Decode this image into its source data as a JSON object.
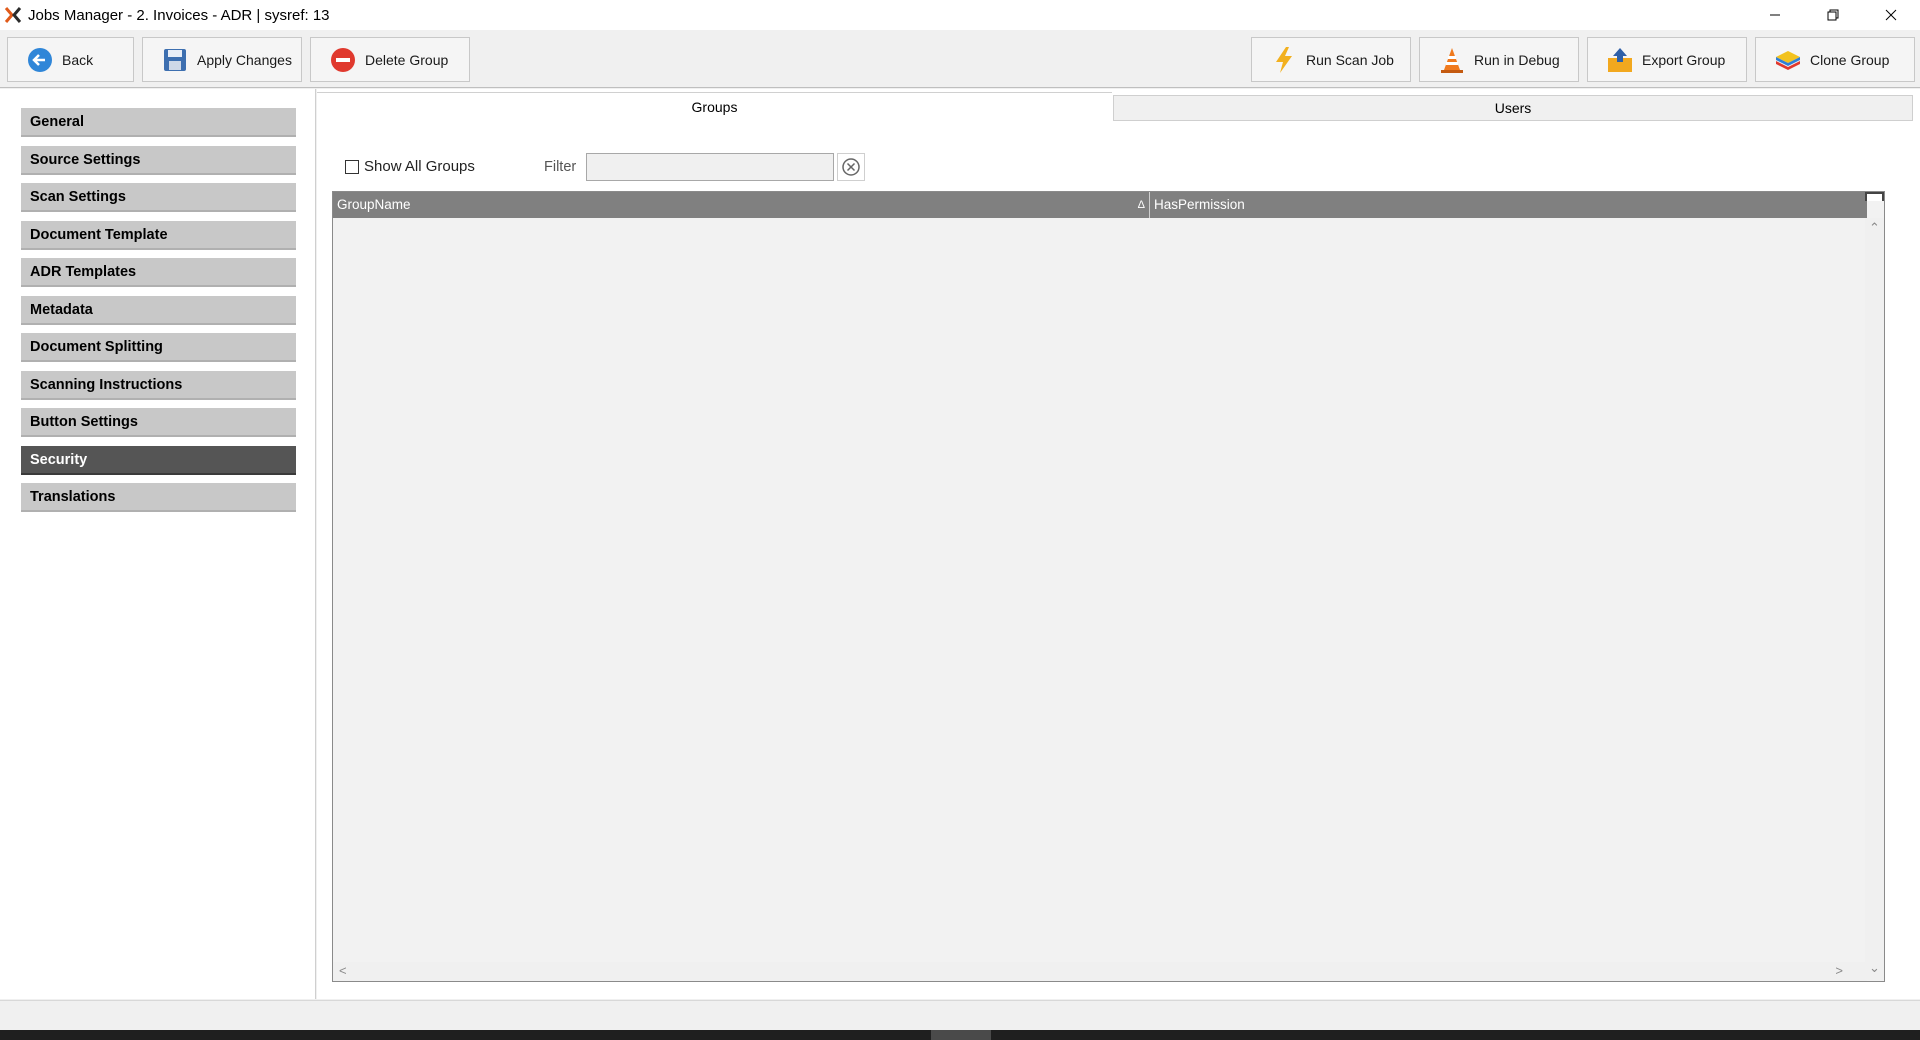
{
  "window": {
    "title": "Jobs Manager - 2. Invoices - ADR  |  sysref: 13",
    "controls": [
      "minimize-icon",
      "restore-icon",
      "close-icon"
    ]
  },
  "toolbar": {
    "back_label": "Back",
    "apply_label": "Apply Changes",
    "delete_label": "Delete Group",
    "run_scan_label": "Run Scan Job",
    "run_debug_label": "Run in Debug",
    "export_label": "Export Group",
    "clone_label": "Clone Group"
  },
  "sidebar": {
    "items": [
      {
        "label": "General"
      },
      {
        "label": "Source Settings"
      },
      {
        "label": "Scan Settings"
      },
      {
        "label": "Document Template"
      },
      {
        "label": "ADR Templates"
      },
      {
        "label": "Metadata"
      },
      {
        "label": "Document Splitting"
      },
      {
        "label": "Scanning Instructions"
      },
      {
        "label": "Button Settings"
      },
      {
        "label": "Security"
      },
      {
        "label": "Translations"
      }
    ],
    "active": "Security"
  },
  "tabs": {
    "groups_label": "Groups",
    "users_label": "Users"
  },
  "filter": {
    "show_all_label": "Show All Groups",
    "show_all_checked": false,
    "filter_label": "Filter",
    "filter_value": ""
  },
  "grid": {
    "columns": [
      "GroupName",
      "HasPermission"
    ],
    "sort_column": "GroupName",
    "rows": []
  },
  "colors": {
    "nav_item": "#c8c8c8",
    "nav_active": "#555555",
    "grid_header": "#808080"
  }
}
